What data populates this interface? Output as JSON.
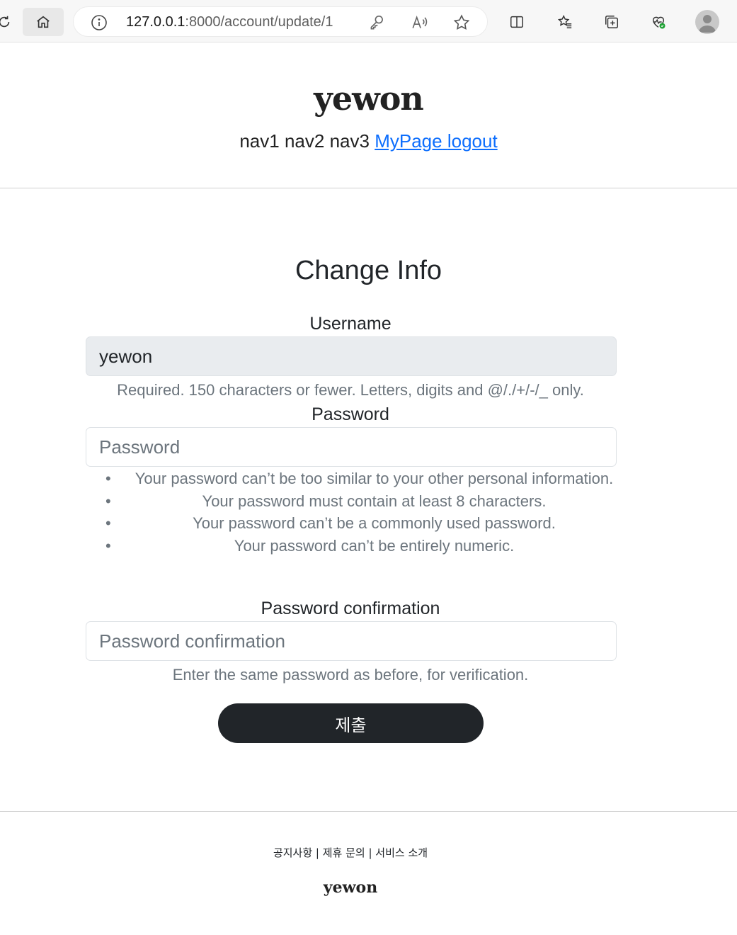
{
  "browser": {
    "url_host": "127.0.0.1",
    "url_path": ":8000/account/update/1",
    "icons": [
      "refresh-icon",
      "home-icon",
      "info-icon",
      "key-icon",
      "read-aloud-icon",
      "favorite-star-icon",
      "split-screen-icon",
      "favorites-icon",
      "collections-icon",
      "health-icon",
      "profile-avatar"
    ]
  },
  "header": {
    "logo": "yewon",
    "nav": {
      "nav1": "nav1",
      "nav2": "nav2",
      "nav3": "nav3",
      "mypage": "MyPage",
      "logout": "logout"
    }
  },
  "form": {
    "title": "Change Info",
    "username": {
      "label": "Username",
      "value": "yewon",
      "help": "Required. 150 characters or fewer. Letters, digits and @/./+/-/_ only."
    },
    "password": {
      "label": "Password",
      "placeholder": "Password",
      "rules": [
        "Your password can’t be too similar to your other personal information.",
        "Your password must contain at least 8 characters.",
        "Your password can’t be a commonly used password.",
        "Your password can’t be entirely numeric."
      ]
    },
    "password_confirmation": {
      "label": "Password confirmation",
      "placeholder": "Password confirmation",
      "help": "Enter the same password as before, for verification."
    },
    "submit_label": "제출"
  },
  "footer": {
    "links": "공지사항 | 제휴 문의 | 서비스 소개",
    "logo": "yewon"
  },
  "colors": {
    "link": "#0d6efd",
    "button_bg": "#212529",
    "muted_text": "#6c757d",
    "disabled_input_bg": "#e9ecef"
  }
}
